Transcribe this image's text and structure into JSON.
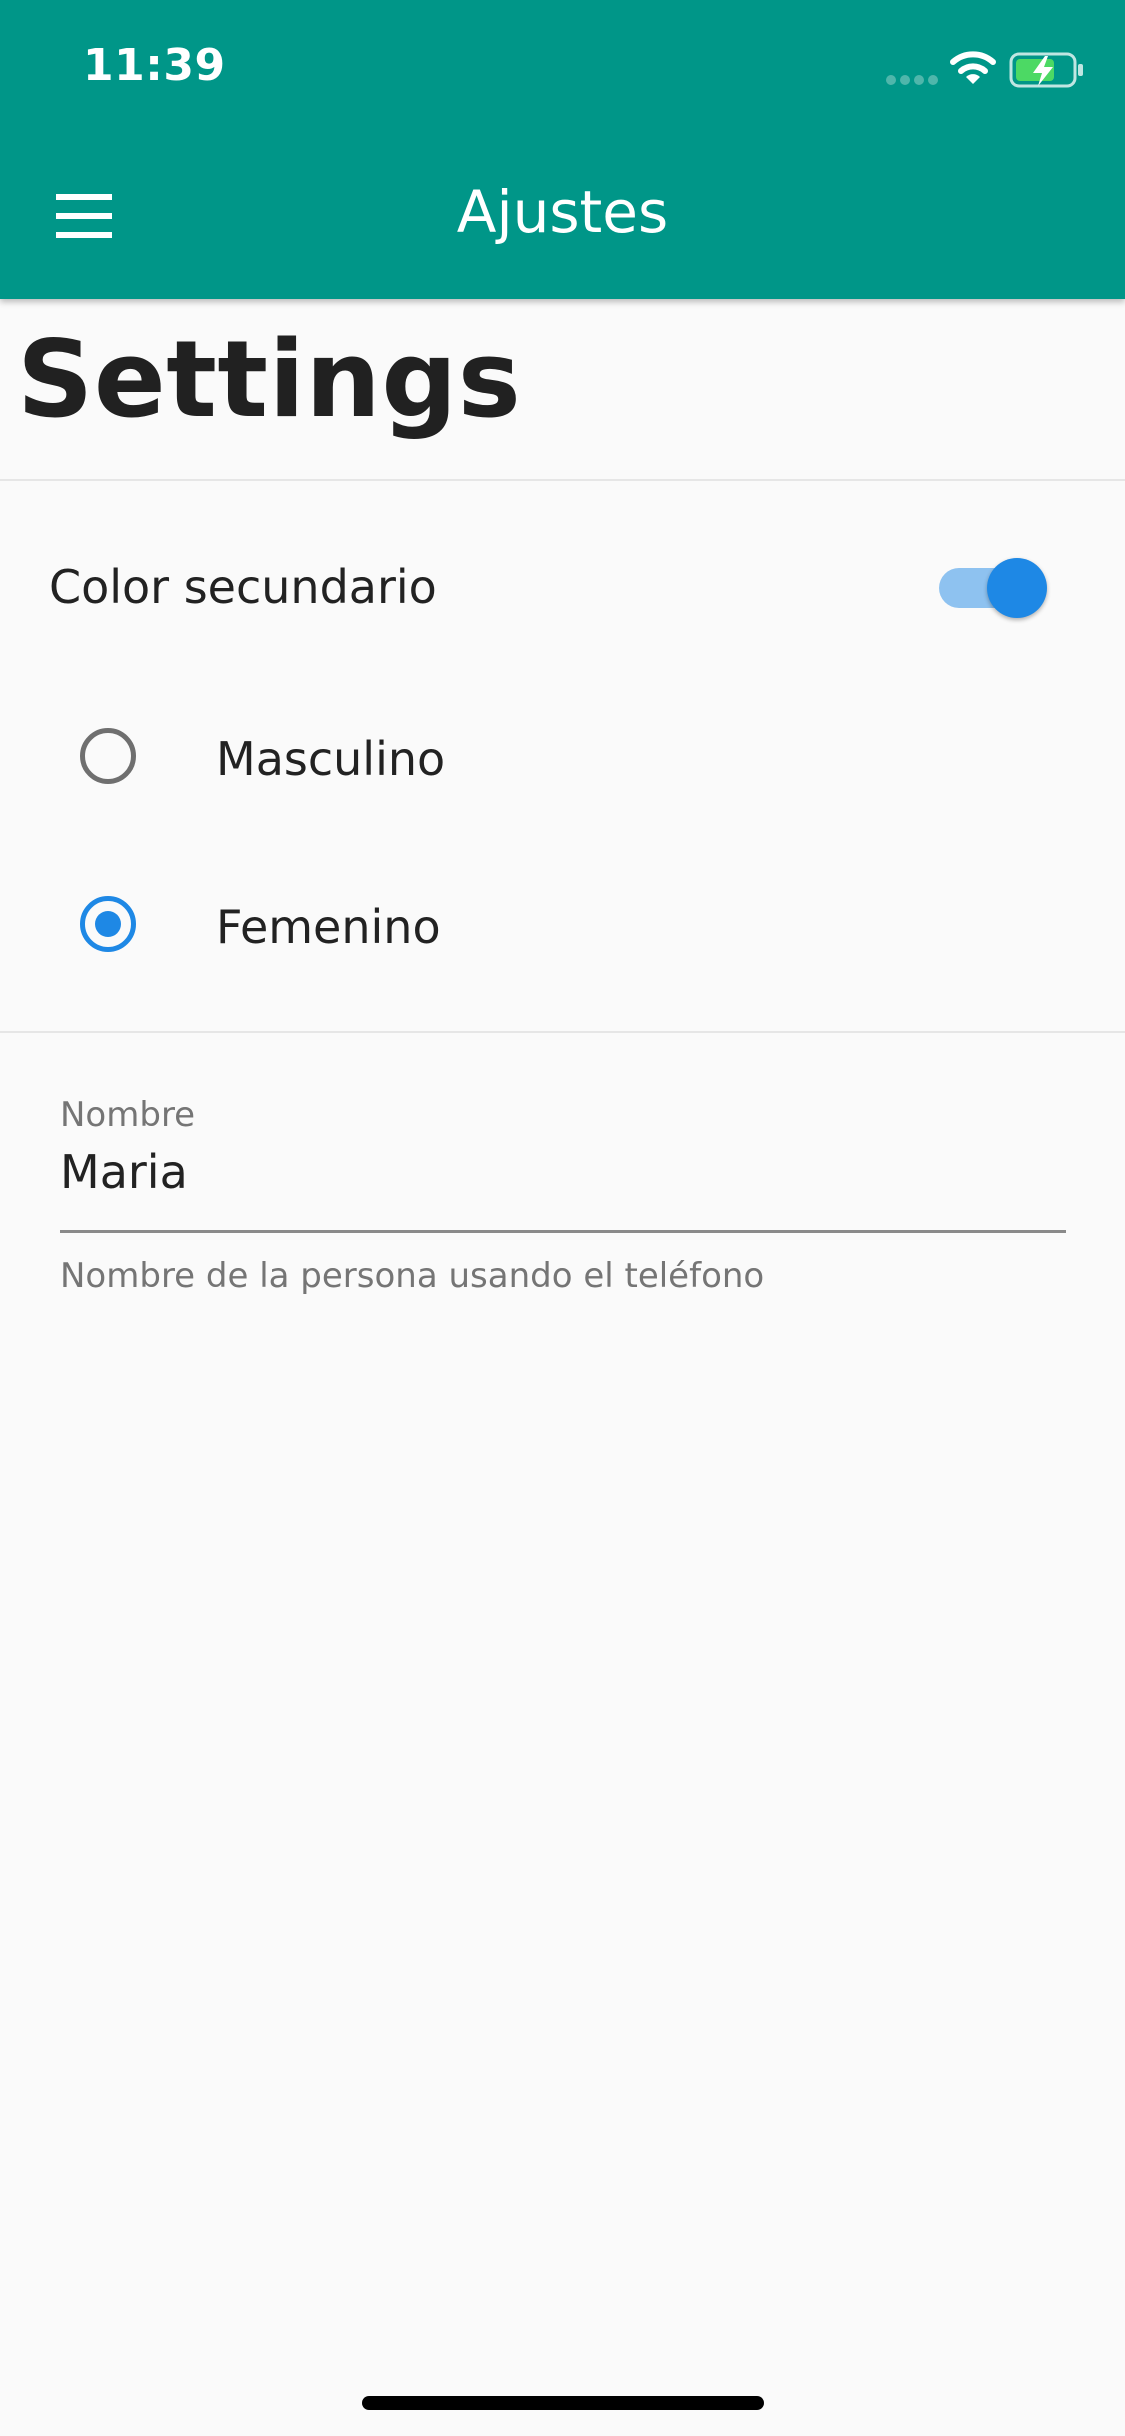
{
  "status_bar": {
    "time": "11:39",
    "icons": [
      "cellular-signal-icon",
      "wifi-icon",
      "battery-charging-icon"
    ]
  },
  "app_bar": {
    "menu_icon": "hamburger-menu-icon",
    "title": "Ajustes",
    "background_color": "#009688"
  },
  "page": {
    "title": "Settings"
  },
  "settings": {
    "secondary_color": {
      "label": "Color secundario",
      "enabled": true,
      "accent_color": "#1e88e5"
    },
    "gender": {
      "options": [
        {
          "label": "Masculino",
          "selected": false
        },
        {
          "label": "Femenino",
          "selected": true
        }
      ]
    },
    "name_field": {
      "label": "Nombre",
      "value": "Maria",
      "helper": "Nombre de la persona usando el teléfono"
    }
  }
}
